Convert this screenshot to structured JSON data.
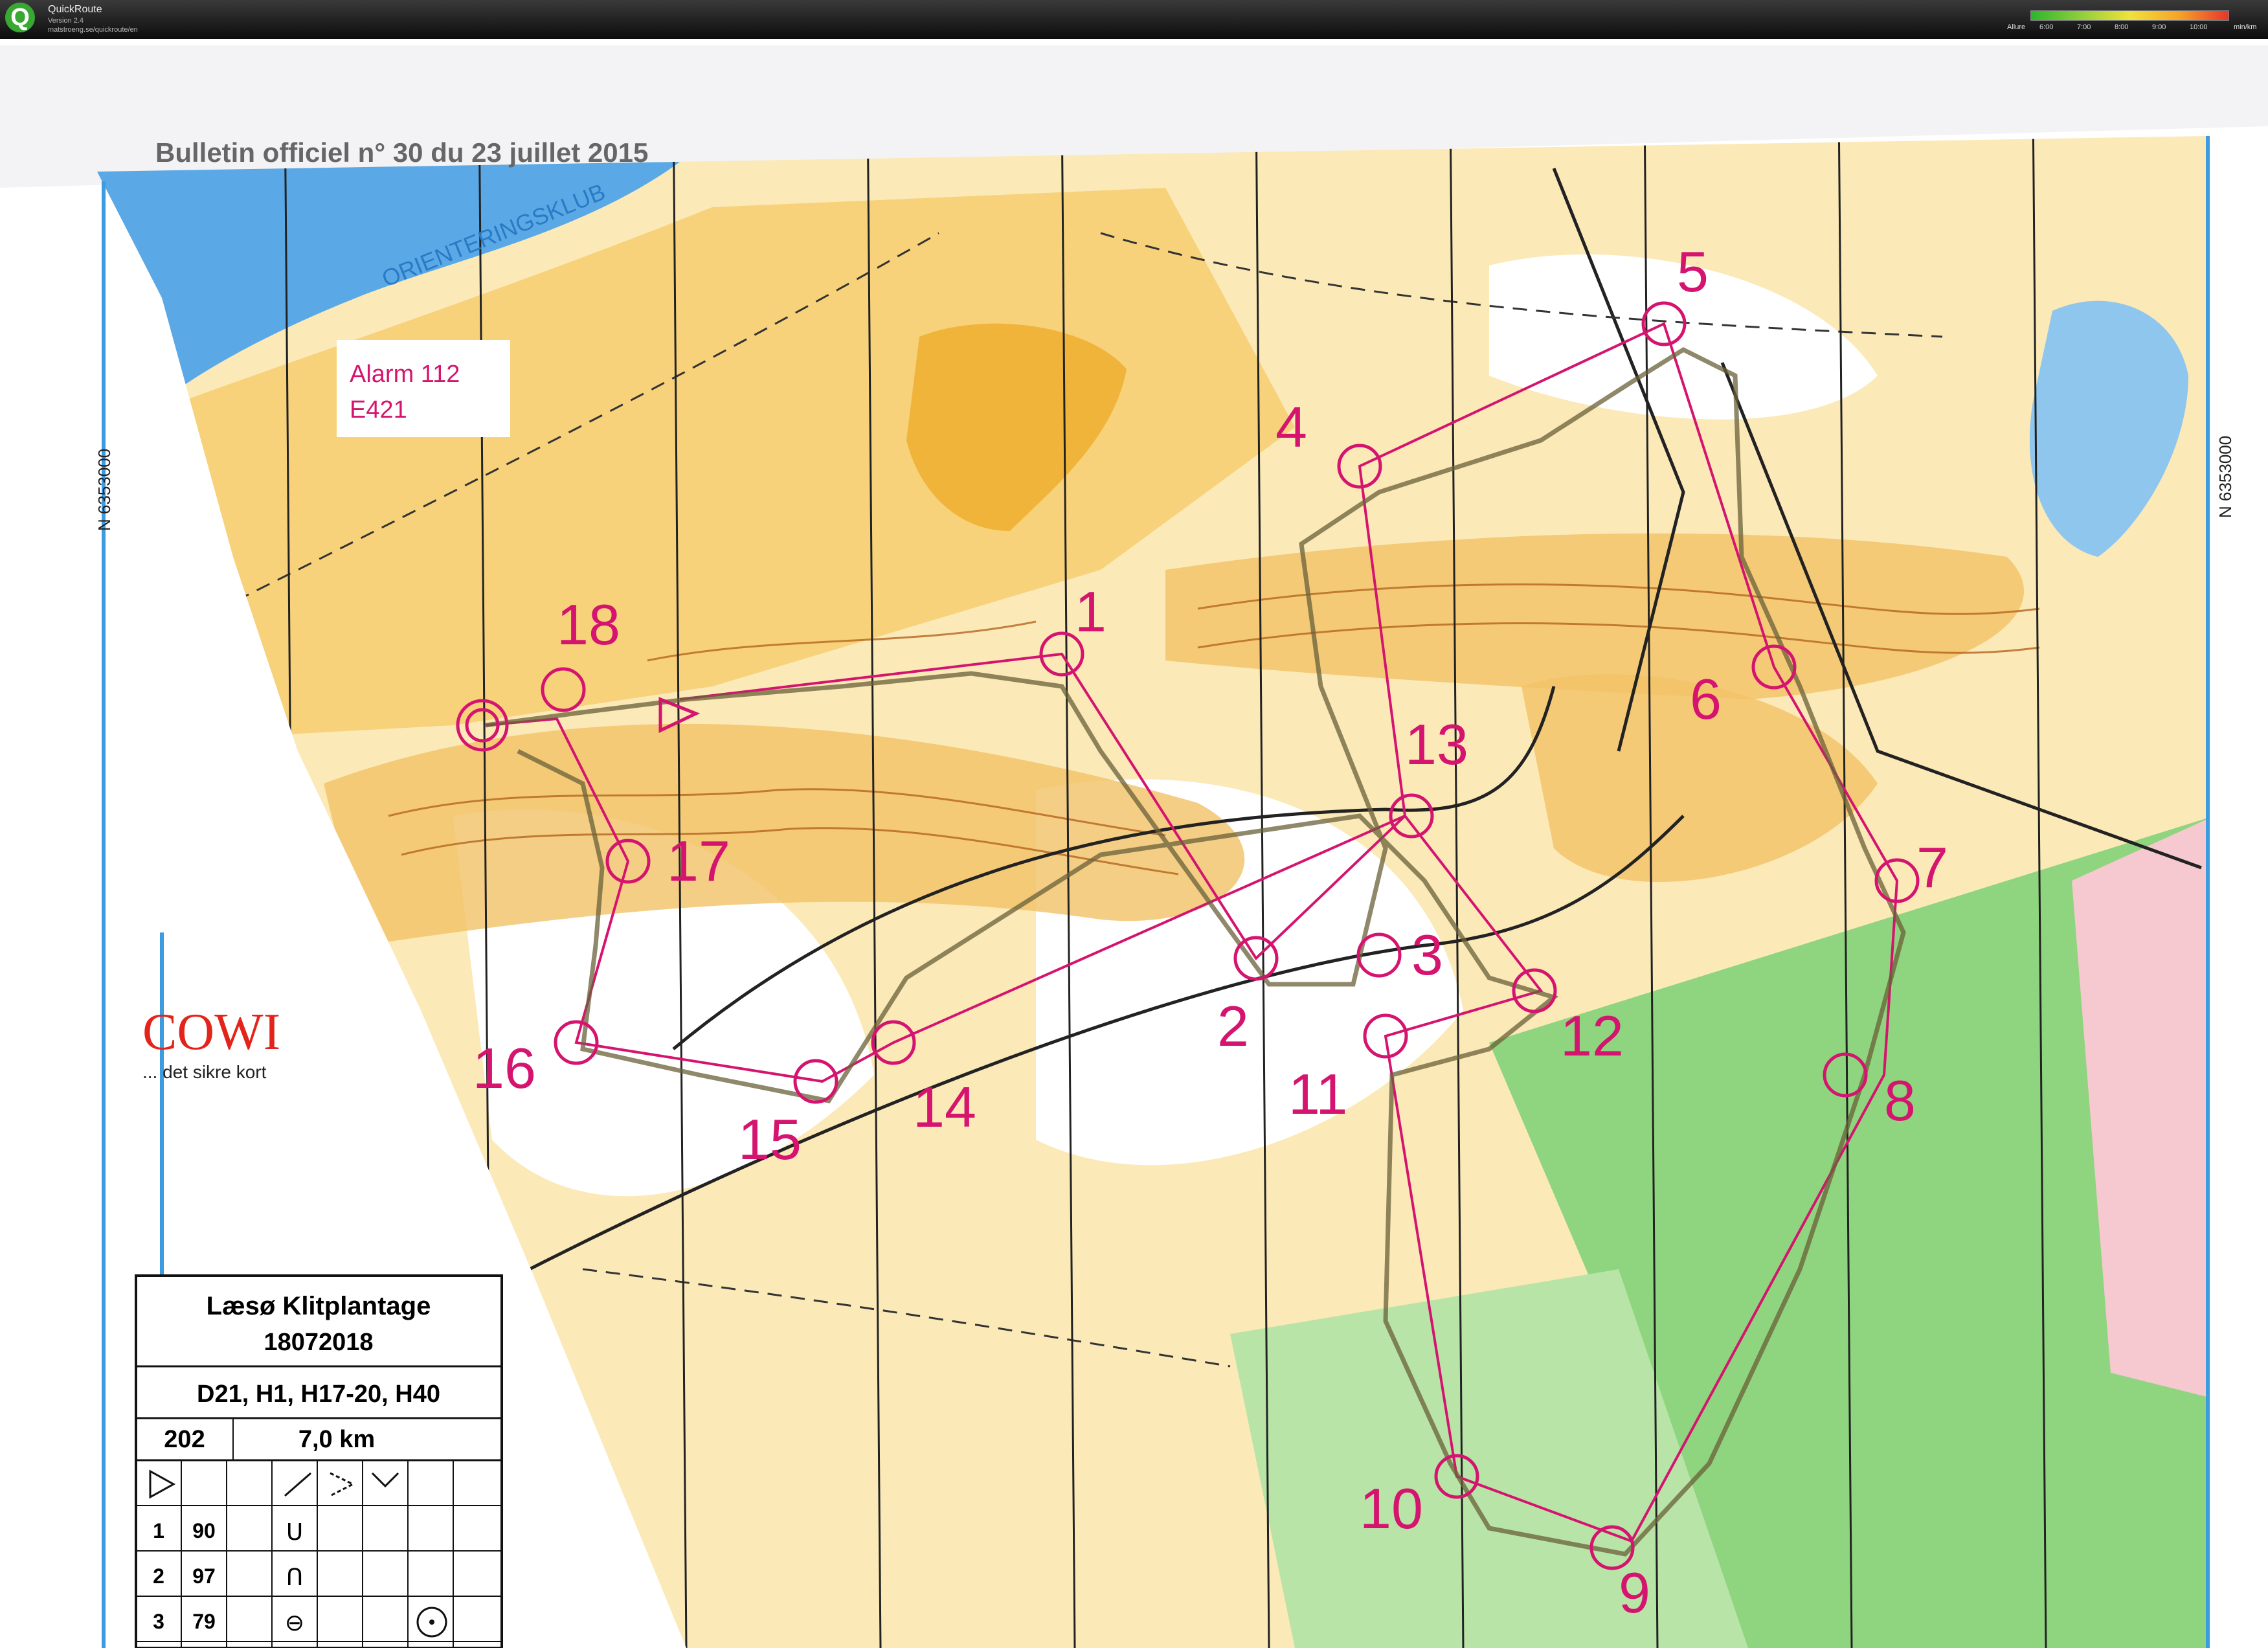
{
  "app": {
    "name": "QuickRoute",
    "version": "Version 2.4",
    "url": "matstroeng.se/quickroute/en"
  },
  "pace_legend": {
    "label": "Allure",
    "ticks": [
      "6:00",
      "7:00",
      "8:00",
      "9:00",
      "10:00"
    ],
    "unit": "min/km",
    "colors": [
      "#2db52d",
      "#8fcf3a",
      "#f0e23a",
      "#f7a32a",
      "#e8352a"
    ]
  },
  "map": {
    "bulletin_header": "Bulletin officiel n° 30 du 23 juillet 2015",
    "club_name": "ORIENTERINGSKLUB",
    "alarm": [
      "Alarm 112",
      "E421"
    ],
    "grid_left": "N 6353000",
    "grid_right": "N 6353000",
    "sponsor_logo": "COWI",
    "sponsor_tagline": "... det sikre kort",
    "control_numbers": [
      "1",
      "2",
      "3",
      "4",
      "5",
      "6",
      "7",
      "8",
      "9",
      "10",
      "11",
      "12",
      "13",
      "14",
      "15",
      "16",
      "17",
      "18"
    ],
    "colors": {
      "water": "#5aa9e6",
      "open_land": "#f7d27a",
      "rough_open": "#fbe9b8",
      "forest_green": "#8fd47e",
      "contour": "#b5651d",
      "course": "#d4146f",
      "route": "#6a6038"
    }
  },
  "legend_box": {
    "title": "Læsø Klitplantage",
    "date": "18072018",
    "classes": "D21, H1, H17-20, H40",
    "course_code": "202",
    "distance": "7,0 km",
    "rows": [
      {
        "num": "1",
        "code": "90",
        "symbol": "ᑌ"
      },
      {
        "num": "2",
        "code": "97",
        "symbol": "Ո"
      },
      {
        "num": "3",
        "code": "79",
        "symbol": "⊖"
      }
    ]
  }
}
